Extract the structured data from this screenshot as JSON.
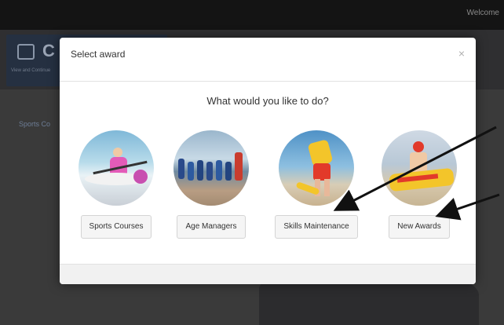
{
  "topbar": {
    "welcome": "Welcome"
  },
  "app": {
    "title": "C",
    "subtitle": "View and\nContinue",
    "side_link": "Sports Co"
  },
  "modal": {
    "title": "Select award",
    "close": "×",
    "prompt": "What would you like to do?",
    "options": [
      {
        "label": "Sports Courses",
        "image": "sports-courses-photo"
      },
      {
        "label": "Age Managers",
        "image": "age-managers-photo"
      },
      {
        "label": "Skills Maintenance",
        "image": "skills-maintenance-photo"
      },
      {
        "label": "New Awards",
        "image": "new-awards-photo"
      }
    ]
  },
  "colors": {
    "modal_bg": "#ffffff",
    "backdrop": "#3a3a3a",
    "arrow": "#111111",
    "rescue_red": "#e23a2a",
    "rescue_yellow": "#f3c52a"
  }
}
